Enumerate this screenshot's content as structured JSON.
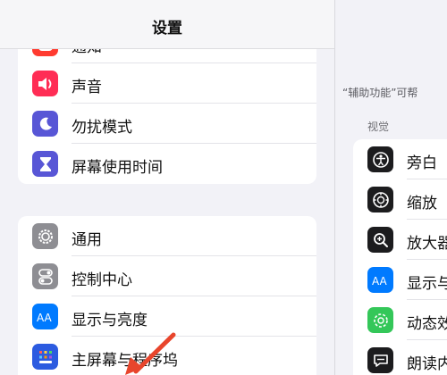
{
  "settings": {
    "title": "设置",
    "group1": [
      {
        "label": "通知",
        "icon": "notifications-icon",
        "color": "#ff3b30"
      },
      {
        "label": "声音",
        "icon": "sound-icon",
        "color": "#ff2d55"
      },
      {
        "label": "勿扰模式",
        "icon": "moon-icon",
        "color": "#5856d6"
      },
      {
        "label": "屏幕使用时间",
        "icon": "hourglass-icon",
        "color": "#5856d6"
      }
    ],
    "group2": [
      {
        "label": "通用",
        "icon": "gear-icon",
        "color": "#8e8e93"
      },
      {
        "label": "控制中心",
        "icon": "toggles-icon",
        "color": "#8e8e93"
      },
      {
        "label": "显示与亮度",
        "icon": "text-size-icon",
        "color": "#007aff"
      },
      {
        "label": "主屏幕与程序坞",
        "icon": "home-screen-icon",
        "color": "#2c5be0"
      }
    ]
  },
  "accessibility": {
    "intro": "“辅助功能”可帮",
    "section": "视觉",
    "items": [
      {
        "label": "旁白",
        "icon": "voiceover-icon",
        "color": "#1c1c1e"
      },
      {
        "label": "缩放",
        "icon": "zoom-icon",
        "color": "#1c1c1e"
      },
      {
        "label": "放大器",
        "icon": "magnifier-icon",
        "color": "#1c1c1e"
      },
      {
        "label": "显示与",
        "icon": "text-size-icon",
        "color": "#007aff"
      },
      {
        "label": "动态效",
        "icon": "motion-icon",
        "color": "#34c759"
      },
      {
        "label": "朗读内",
        "icon": "speech-icon",
        "color": "#1c1c1e"
      }
    ]
  },
  "annotation": {
    "color": "#e8452c"
  }
}
